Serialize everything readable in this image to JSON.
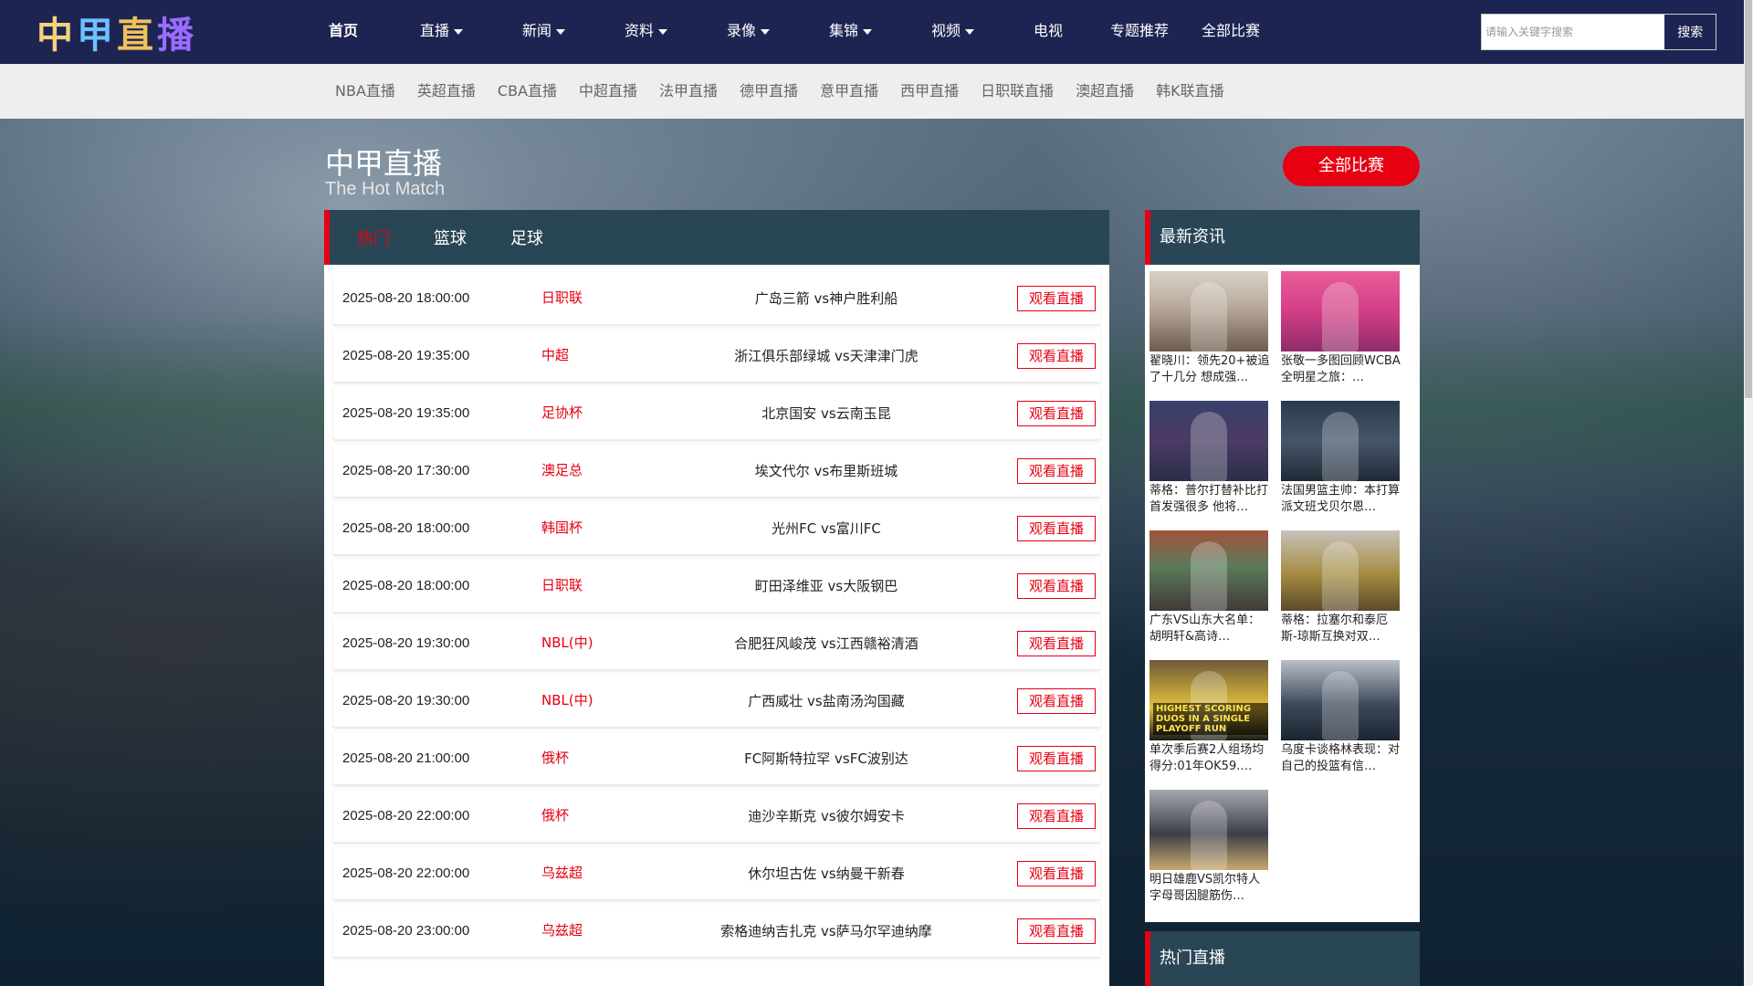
{
  "logo": {
    "chars": [
      "中",
      "甲",
      "直",
      "播"
    ]
  },
  "nav": {
    "items": [
      {
        "label": "首页",
        "caret": false,
        "active": true
      },
      {
        "label": "直播",
        "caret": true
      },
      {
        "label": "新闻",
        "caret": true
      },
      {
        "label": "资料",
        "caret": true
      },
      {
        "label": "录像",
        "caret": true
      },
      {
        "label": "集锦",
        "caret": true
      },
      {
        "label": "视频",
        "caret": true
      },
      {
        "label": "电视",
        "caret": false
      },
      {
        "label": "专题推荐",
        "caret": false
      },
      {
        "label": "全部比赛",
        "caret": false
      }
    ]
  },
  "search": {
    "placeholder": "请输入关键字搜索",
    "button": "搜索"
  },
  "subnav": [
    "NBA直播",
    "英超直播",
    "CBA直播",
    "中超直播",
    "法甲直播",
    "德甲直播",
    "意甲直播",
    "西甲直播",
    "日职联直播",
    "澳超直播",
    "韩K联直播"
  ],
  "hero": {
    "title": "中甲直播",
    "subtitle": "The Hot Match",
    "all_button": "全部比赛"
  },
  "tabs": [
    "热门",
    "篮球",
    "足球"
  ],
  "watch_label": "观看直播",
  "matches": [
    {
      "time": "2025-08-20 18:00:00",
      "league": "日职联",
      "home": "广岛三箭",
      "away": "神户胜利船"
    },
    {
      "time": "2025-08-20 19:35:00",
      "league": "中超",
      "home": "浙江俱乐部绿城",
      "away": "天津津门虎"
    },
    {
      "time": "2025-08-20 19:35:00",
      "league": "足协杯",
      "home": "北京国安",
      "away": "云南玉昆"
    },
    {
      "time": "2025-08-20 17:30:00",
      "league": "澳足总",
      "home": "埃文代尔",
      "away": "布里斯班城"
    },
    {
      "time": "2025-08-20 18:00:00",
      "league": "韩国杯",
      "home": "光州FC",
      "away": "富川FC"
    },
    {
      "time": "2025-08-20 18:00:00",
      "league": "日职联",
      "home": "町田泽维亚",
      "away": "大阪钢巴"
    },
    {
      "time": "2025-08-20 19:30:00",
      "league": "NBL(中)",
      "home": "合肥狂风峻茂",
      "away": "江西赣裕清酒"
    },
    {
      "time": "2025-08-20 19:30:00",
      "league": "NBL(中)",
      "home": "广西威壮",
      "away": "盐南汤沟国藏"
    },
    {
      "time": "2025-08-20 21:00:00",
      "league": "俄杯",
      "home": "FC阿斯特拉罕",
      "away": "FC波别达"
    },
    {
      "time": "2025-08-20 22:00:00",
      "league": "俄杯",
      "home": "迪沙辛斯克",
      "away": "彼尔姆安卡"
    },
    {
      "time": "2025-08-20 22:00:00",
      "league": "乌兹超",
      "home": "休尔坦古佐",
      "away": "纳曼干新春"
    },
    {
      "time": "2025-08-20 23:00:00",
      "league": "乌兹超",
      "home": "索格迪纳吉扎克",
      "away": "萨马尔罕迪纳摩"
    }
  ],
  "vs": "vs",
  "news": {
    "title": "最新资讯",
    "items": [
      {
        "title": "翟晓川：领先20+被追了十几分 想成强…",
        "thumb": "t1"
      },
      {
        "title": "张敬一多图回顾WCBA全明星之旅：…",
        "thumb": "t2"
      },
      {
        "title": "蒂格：普尔打替补比打首发强很多 他将…",
        "thumb": "t3"
      },
      {
        "title": "法国男篮主帅：本打算派文班戈贝尔恩…",
        "thumb": "t4"
      },
      {
        "title": "广东VS山东大名单：胡明轩&高诗…",
        "thumb": "t5"
      },
      {
        "title": "蒂格：拉塞尔和泰厄斯-琼斯互换对双…",
        "thumb": "t6"
      },
      {
        "title": "单次季后赛2人组场均得分:01年OK59.…",
        "thumb": "t7"
      },
      {
        "title": "乌度卡谈格林表现：对自己的投篮有信…",
        "thumb": "t8"
      },
      {
        "title": "明日雄鹿VS凯尔特人 字母哥因腿筋伤…",
        "thumb": "t9"
      }
    ],
    "thumb7_banner": "HIGHEST SCORING DUOS IN A SINGLE PLAYOFF RUN"
  },
  "hot": {
    "title": "热门直播"
  }
}
